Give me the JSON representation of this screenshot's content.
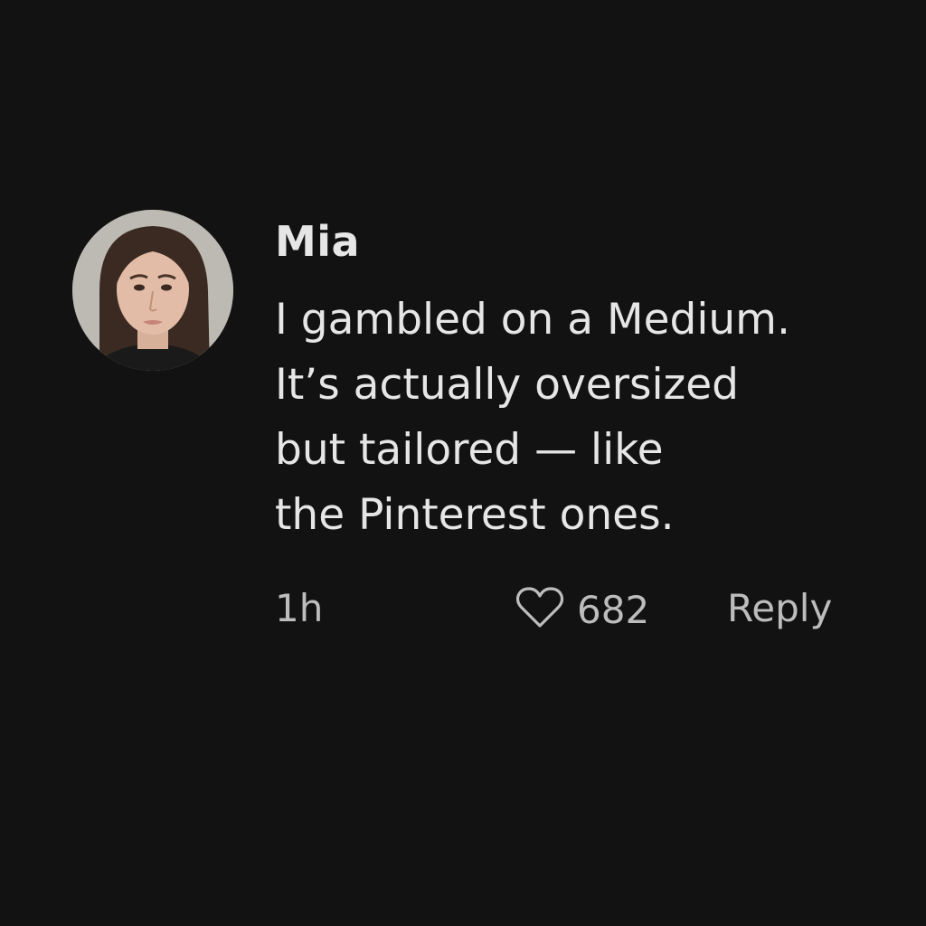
{
  "comment": {
    "username": "Mia",
    "avatar_icon": "user-avatar-photo",
    "lines": [
      "I gambled on a Medium.",
      "It’s actually oversized",
      "but tailored — like",
      "the Pinterest ones."
    ],
    "time": "1h",
    "like_icon": "heart-outline-icon",
    "like_count": "682",
    "reply_label": "Reply"
  },
  "colors": {
    "background": "#121212",
    "primary_text": "#e6e6e6",
    "secondary_text": "#bdbdbd"
  }
}
